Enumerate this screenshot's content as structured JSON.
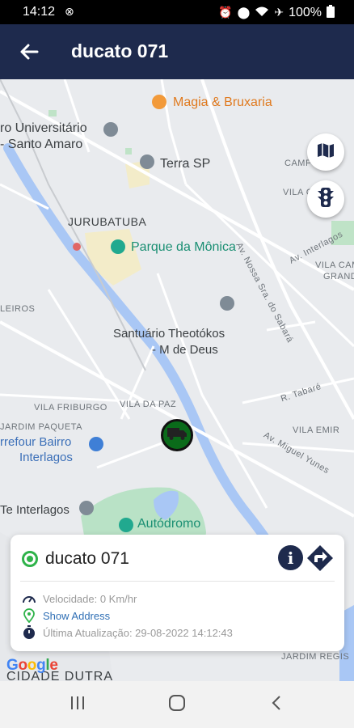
{
  "status_bar": {
    "time": "14:12",
    "battery_text": "100%",
    "icons": [
      "alarm-icon",
      "location-icon",
      "wifi-icon",
      "airplane-icon",
      "battery-icon"
    ]
  },
  "header": {
    "title": "ducato 071",
    "background": "#1e2a4d"
  },
  "map": {
    "labels": {
      "magia": "Magia & Bruxaria",
      "centro_univ_1": "ro Universitário",
      "centro_univ_2": "- Santo Amaro",
      "terra_sp": "Terra SP",
      "jurubatuba": "JURUBATUBA",
      "parque": "Parque da Mônica",
      "santuario_1": "Santuário Theotókos",
      "santuario_2": "- M   de Deus",
      "leiros": "LEIROS",
      "vila_friburgo": "VILA FRIBURGO",
      "vila_da_paz": "VILA DA PAZ",
      "jardim_paqueta": "JARDIM PAQUETA",
      "carrefour_1": "rrefour Bairro",
      "carrefour_2": "Interlagos",
      "te_interlagos": "Te Interlagos",
      "autodromo": "Autódromo",
      "campo": "CAMP",
      "vila_cruz": "VILA C",
      "av_nossa": "Av. Nossa Sra. do Sabará",
      "av_interlagos": "Av. Interlagos",
      "vila_camp_1": "VILA CAM",
      "vila_camp_2": "GRAND",
      "r_tabare": "R. Tabaré",
      "vila_emir": "VILA EMIR",
      "av_miguel": "Av. Miguel Yunes",
      "jardim_regis": "JARDIM REGIS",
      "cidade_dutra": "CIDADE DUTRA"
    },
    "map_button_icon": "map-icon",
    "traffic_button_icon": "traffic-light-icon",
    "marker_icon": "truck-icon",
    "marker_color": "#0a6b1a"
  },
  "vehicle_card": {
    "name": "ducato 071",
    "status_color": "#2fb34a",
    "speed_text": "Velocidade: 0 Km/hr",
    "address_link": "Show Address",
    "last_update_text": "Última Atualização: 29-08-2022 14:12:43"
  },
  "google_logo": "Google",
  "nav_bar": {
    "recent_icon": "recent-apps-icon",
    "home_icon": "home-icon",
    "back_icon": "back-icon"
  }
}
